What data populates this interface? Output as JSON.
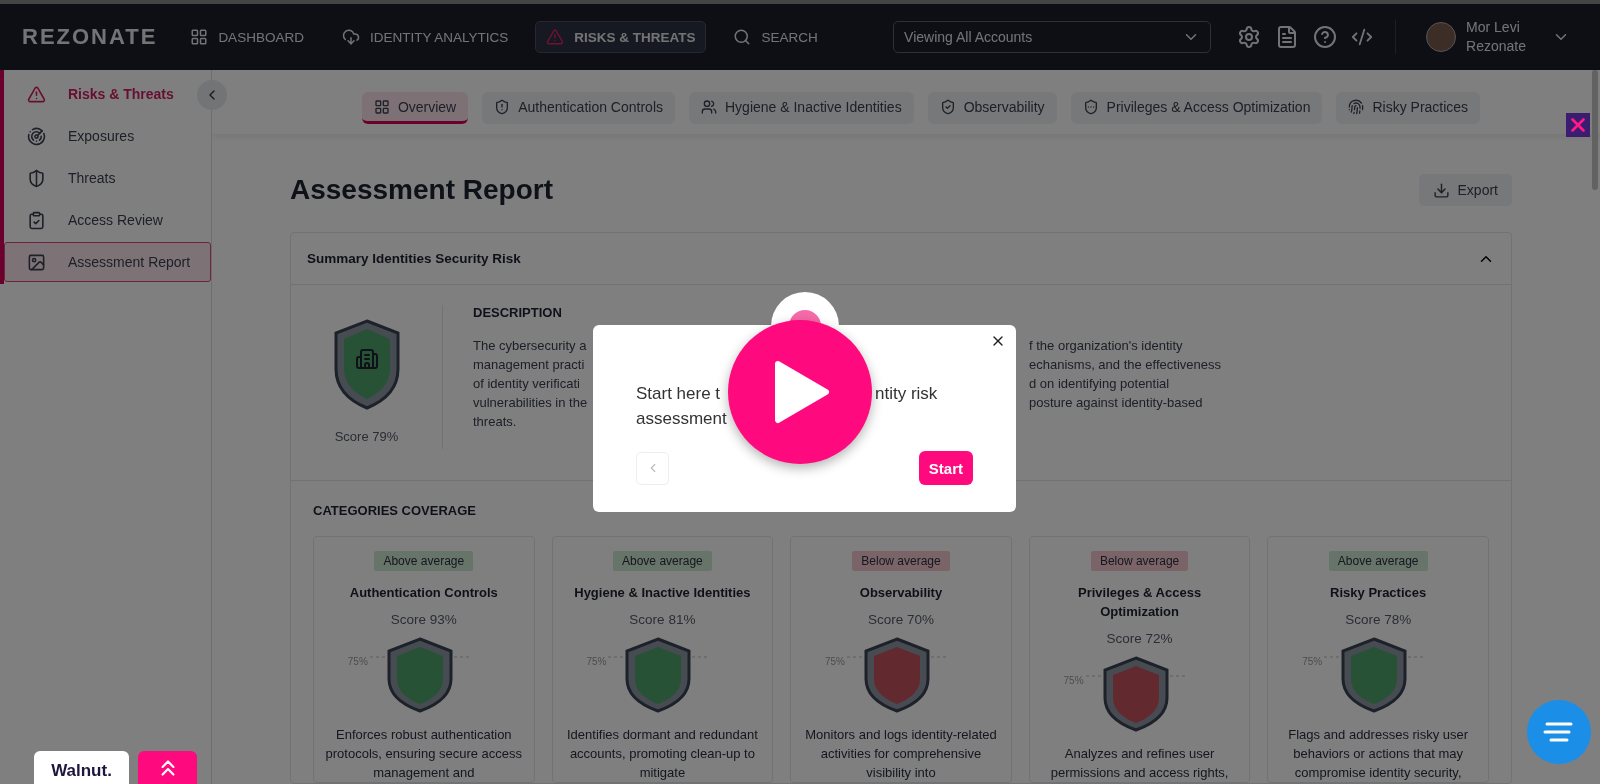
{
  "nav": {
    "logo": "REZONATE",
    "items": [
      {
        "label": "DASHBOARD",
        "selected": false
      },
      {
        "label": "IDENTITY ANALYTICS",
        "selected": false
      },
      {
        "label": "RISKS & THREATS",
        "selected": true
      },
      {
        "label": "SEARCH",
        "selected": false
      }
    ],
    "account_select": "Viewing All Accounts",
    "user": {
      "name": "Mor Levi",
      "org": "Rezonate"
    }
  },
  "sidebar": {
    "items": [
      {
        "label": "Risks & Threats",
        "kind": "section",
        "selected": false
      },
      {
        "label": "Exposures",
        "kind": "link",
        "selected": false
      },
      {
        "label": "Threats",
        "kind": "link",
        "selected": false
      },
      {
        "label": "Access Review",
        "kind": "link",
        "selected": false
      },
      {
        "label": "Assessment Report",
        "kind": "link",
        "selected": true
      }
    ]
  },
  "tabs": [
    {
      "label": "Overview",
      "selected": true
    },
    {
      "label": "Authentication Controls",
      "selected": false
    },
    {
      "label": "Hygiene & Inactive Identities",
      "selected": false
    },
    {
      "label": "Observability",
      "selected": false
    },
    {
      "label": "Privileges & Access Optimization",
      "selected": false
    },
    {
      "label": "Risky Practices",
      "selected": false
    }
  ],
  "page": {
    "title": "Assessment Report",
    "export": "Export"
  },
  "summary": {
    "title": "Summary Identities Security Risk",
    "expanded": true,
    "score": "Score 79%",
    "description_heading": "DESCRIPTION",
    "description_left": [
      "The cybersecurity a",
      "management practi",
      "of identity verificati",
      "vulnerabilities in the",
      "threats."
    ],
    "description_right": [
      "f the organization's identity",
      "echanisms, and the effectiveness",
      "d on identifying potential",
      "posture against identity-based"
    ]
  },
  "categories": {
    "title": "CATEGORIES COVERAGE",
    "cards": [
      {
        "badge": "Above average",
        "kind": "above",
        "title": "Authentication Controls",
        "score": "Score 93%",
        "benchmark": "75%",
        "description": "Enforces robust authentication protocols, ensuring secure access management and"
      },
      {
        "badge": "Above average",
        "kind": "above",
        "title": "Hygiene & Inactive Identities",
        "score": "Score 81%",
        "benchmark": "75%",
        "description": "Identifies dormant and redundant accounts, promoting clean-up to mitigate"
      },
      {
        "badge": "Below average",
        "kind": "below",
        "title": "Observability",
        "score": "Score 70%",
        "benchmark": "75%",
        "description": "Monitors and logs identity-related activities for comprehensive visibility into"
      },
      {
        "badge": "Below average",
        "kind": "below",
        "title": "Privileges & Access Optimization",
        "score": "Score 72%",
        "benchmark": "75%",
        "description": "Analyzes and refines user permissions and access rights,"
      },
      {
        "badge": "Above average",
        "kind": "above",
        "title": "Risky Practices",
        "score": "Score 78%",
        "benchmark": "75%",
        "description": "Flags and addresses risky user behaviors or actions that may compromise identity security,"
      }
    ]
  },
  "tour": {
    "text_left": "Start here t",
    "text_right": "ntity risk",
    "text_line2": "assessment",
    "start": "Start"
  },
  "walnut": {
    "logo": "Walnut."
  }
}
